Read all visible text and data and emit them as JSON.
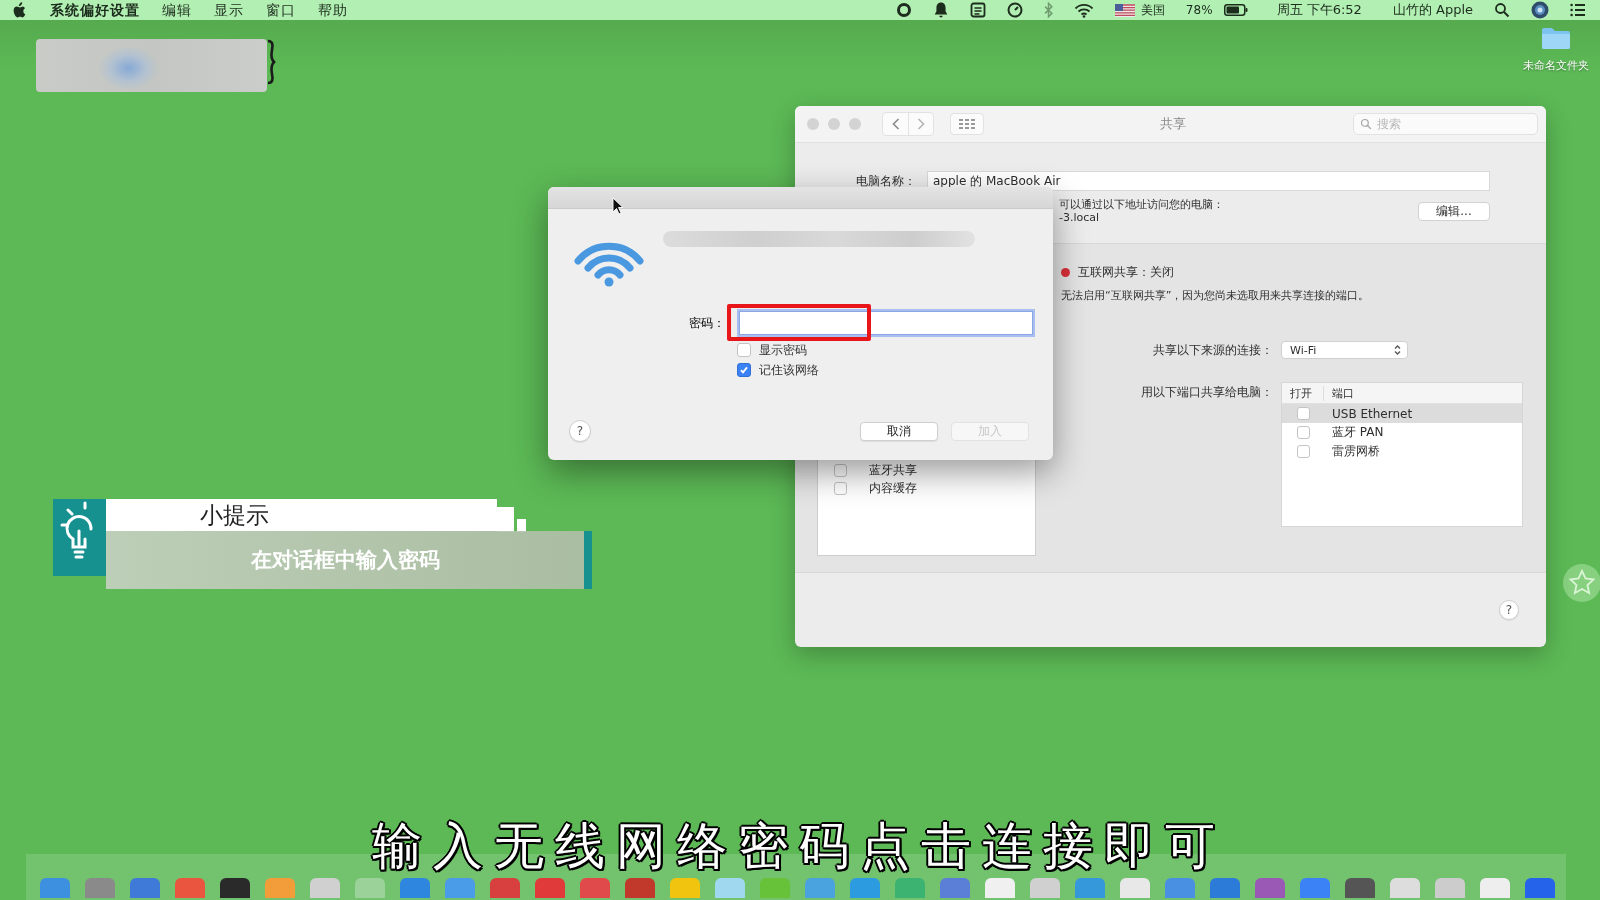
{
  "menu_bar": {
    "menus": [
      "系统偏好设置",
      "编辑",
      "显示",
      "窗口",
      "帮助"
    ],
    "input_source": "美国",
    "battery": "78%",
    "clock": "周五 下午6:52",
    "user": "山竹的 Apple"
  },
  "desktop": {
    "folder": "未命名文件夹"
  },
  "sharing_window": {
    "title": "共享",
    "search": {
      "placeholder": "搜索"
    },
    "computer_name": {
      "label": "电脑名称：",
      "value": "apple 的 MacBook Air"
    },
    "address_note": "可以通过以下地址访问您的电脑：",
    "address": "-3.local",
    "edit_button": "编辑...",
    "services": [
      {
        "label": "蓝牙共享",
        "checked": false
      },
      {
        "label": "内容缓存",
        "checked": false
      }
    ],
    "internet_sharing": {
      "status": "互联网共享：关闭",
      "on": false,
      "message": "无法启用“互联网共享”，因为您尚未选取用来共享连接的端口。"
    },
    "share_from": {
      "label": "共享以下来源的连接：",
      "value": "Wi-Fi"
    },
    "share_to": {
      "label": "用以下端口共享给电脑：",
      "columns": [
        "打开",
        "端口"
      ],
      "rows": [
        {
          "port": "USB Ethernet",
          "checked": false,
          "selected": true
        },
        {
          "port": "蓝牙 PAN",
          "checked": false,
          "selected": false
        },
        {
          "port": "雷雳网桥",
          "checked": false,
          "selected": false
        }
      ]
    },
    "help": "?"
  },
  "wifi_dialog": {
    "password_label": "密码：",
    "password_field": {
      "focused": true,
      "highlighted": true
    },
    "options": [
      {
        "label": "显示密码",
        "checked": false
      },
      {
        "label": "记住该网络",
        "checked": true
      }
    ],
    "help": "?",
    "buttons": [
      {
        "label": "取消",
        "disabled": false
      },
      {
        "label": "加入",
        "disabled": true
      }
    ]
  },
  "tip": {
    "title": "小提示",
    "text": "在对话框中输入密码"
  },
  "subtitle": "输入无线网络密码点击连接即可"
}
